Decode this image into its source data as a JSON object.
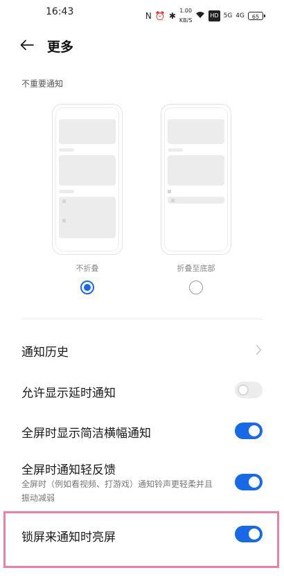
{
  "status_bar": {
    "time": "16:43",
    "nfc": "N",
    "alarm": "⏰",
    "bluetooth": "✱",
    "speed_value": "1.00",
    "speed_unit": "KB/S",
    "hd": "HD",
    "sig1": "5G",
    "sig2": "4G",
    "battery": "65"
  },
  "header": {
    "title": "更多"
  },
  "section": {
    "label": "不重要通知"
  },
  "options": [
    {
      "label": "不折叠",
      "selected": true
    },
    {
      "label": "折叠至底部",
      "selected": false
    }
  ],
  "items": {
    "history": {
      "title": "通知历史"
    },
    "delayed": {
      "title": "允许显示延时通知",
      "enabled": false
    },
    "fullscreen_banner": {
      "title": "全屏时显示简洁横幅通知",
      "enabled": true
    },
    "fullscreen_light": {
      "title": "全屏时通知轻反馈",
      "subtitle": "全屏时（例如看视频、打游戏）通知铃声更轻柔并且振动减弱",
      "enabled": true
    },
    "lockscreen_wake": {
      "title": "锁屏来通知时亮屏",
      "enabled": true
    }
  },
  "colors": {
    "accent": "#1769e8",
    "highlight": "#ec7fa9"
  }
}
